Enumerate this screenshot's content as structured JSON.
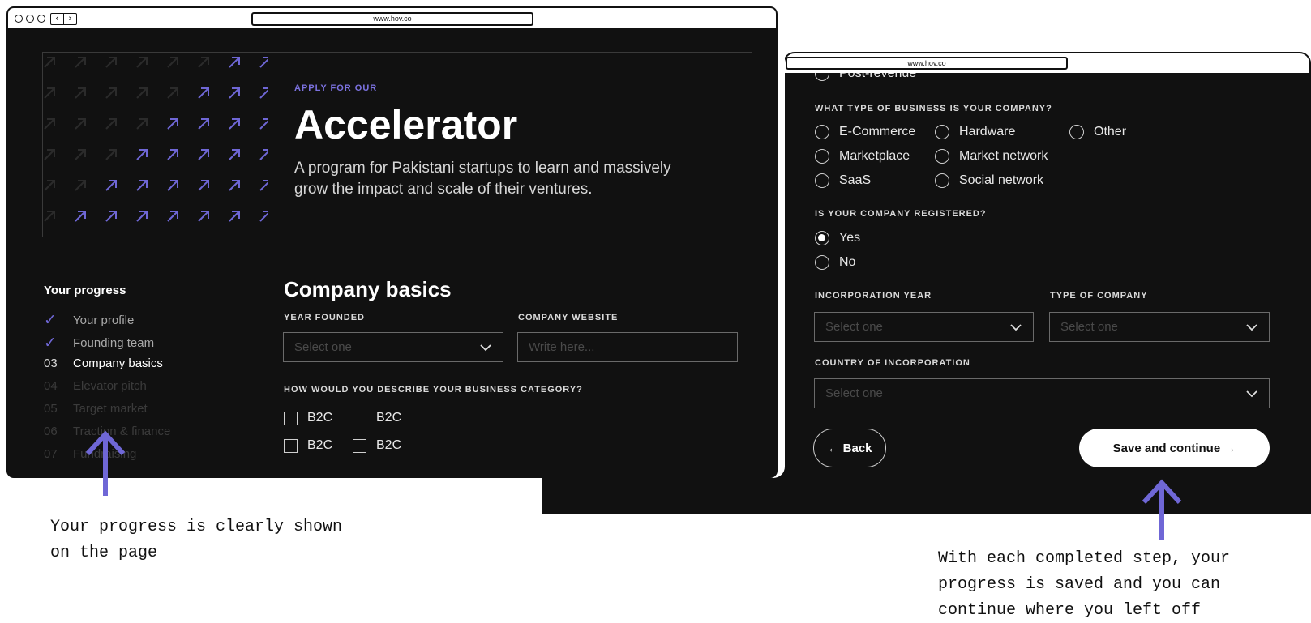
{
  "colors": {
    "accent": "#6f67d6",
    "background": "#111111",
    "text": "#ffffff"
  },
  "window1": {
    "url": "www.hov.co",
    "hero": {
      "kicker": "APPLY FOR OUR",
      "title": "Accelerator",
      "description": "A program for Pakistani startups to learn and massively grow the impact and scale of their ventures."
    },
    "progress": {
      "title": "Your progress",
      "steps": [
        {
          "marker": "✓",
          "label": "Your profile",
          "state": "done"
        },
        {
          "marker": "✓",
          "label": "Founding team",
          "state": "done"
        },
        {
          "marker": "03",
          "label": "Company basics",
          "state": "current"
        },
        {
          "marker": "04",
          "label": "Elevator pitch",
          "state": "upcoming"
        },
        {
          "marker": "05",
          "label": "Target market",
          "state": "upcoming"
        },
        {
          "marker": "06",
          "label": "Traction & finance",
          "state": "upcoming"
        },
        {
          "marker": "07",
          "label": "Fundraising",
          "state": "upcoming"
        }
      ]
    },
    "form": {
      "title": "Company basics",
      "year_founded_label": "YEAR FOUNDED",
      "year_founded_placeholder": "Select one",
      "website_label": "COMPANY WEBSITE",
      "website_placeholder": "Write here...",
      "category_question": "HOW WOULD YOU DESCRIBE YOUR BUSINESS CATEGORY?",
      "category_options": [
        "B2C",
        "B2C",
        "B2C",
        "B2C"
      ]
    }
  },
  "window2": {
    "url": "www.hov.co",
    "partial_option": "Post-revenue",
    "business_type_question": "WHAT TYPE OF BUSINESS IS YOUR COMPANY?",
    "business_types": [
      "E-Commerce",
      "Hardware",
      "Other",
      "Marketplace",
      "Market network",
      "SaaS",
      "Social network"
    ],
    "registered_question": "IS YOUR COMPANY REGISTERED?",
    "registered_options": [
      {
        "label": "Yes",
        "selected": true
      },
      {
        "label": "No",
        "selected": false
      }
    ],
    "incorporation_year_label": "INCORPORATION YEAR",
    "incorporation_year_placeholder": "Select one",
    "company_type_label": "TYPE OF COMPANY",
    "company_type_placeholder": "Select one",
    "country_label": "COUNTRY OF INCORPORATION",
    "country_placeholder": "Select one",
    "back_label": "← Back",
    "save_label": "Save and continue →"
  },
  "annotations": {
    "left": "Your progress is clearly shown\non the page",
    "right": "With each completed step, your\nprogress is saved and you can\ncontinue where you left off"
  }
}
